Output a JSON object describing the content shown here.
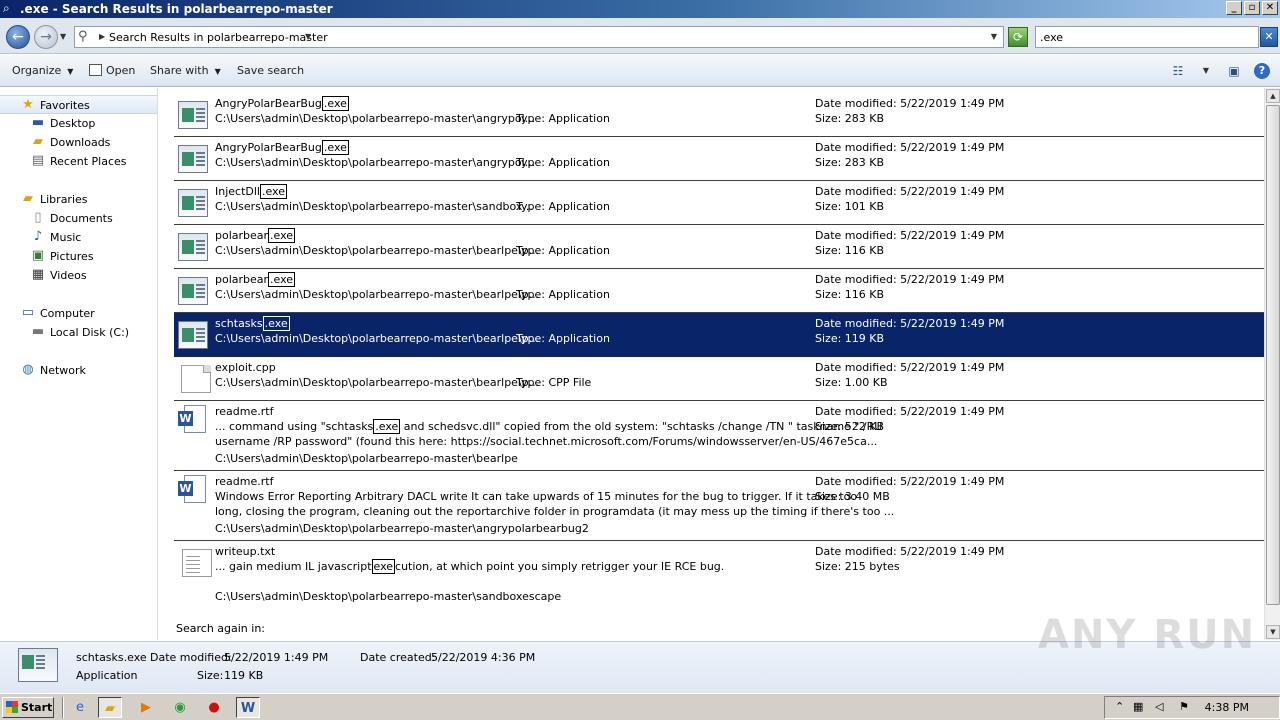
{
  "window": {
    "title": ".exe - Search Results in polarbearrepo-master",
    "buttons": {
      "minimize": "_",
      "maximize": "▫",
      "close": "✕"
    }
  },
  "address": {
    "path": "Search Results in polarbearrepo-master",
    "search_value": ".exe"
  },
  "toolbar": {
    "organize": "Organize",
    "open": "Open",
    "share_with": "Share with",
    "save_search": "Save search"
  },
  "nav": {
    "favorites": "Favorites",
    "desktop": "Desktop",
    "downloads": "Downloads",
    "recent_places": "Recent Places",
    "libraries": "Libraries",
    "documents": "Documents",
    "music": "Music",
    "pictures": "Pictures",
    "videos": "Videos",
    "computer": "Computer",
    "local_disk": "Local Disk (C:)",
    "network": "Network"
  },
  "results": [
    {
      "name_pre": "AngryPolarBearBug",
      "name_hl": ".exe",
      "name_post": "",
      "path": "C:\\Users\\admin\\Desktop\\polarbearrepo-master\\angrypol...",
      "type": "Type: Application",
      "modified": "Date modified: 5/22/2019 1:49 PM",
      "size": "Size: 283 KB"
    },
    {
      "name_pre": "AngryPolarBearBug",
      "name_hl": ".exe",
      "name_post": "",
      "path": "C:\\Users\\admin\\Desktop\\polarbearrepo-master\\angrypol...",
      "type": "Type: Application",
      "modified": "Date modified: 5/22/2019 1:49 PM",
      "size": "Size: 283 KB"
    },
    {
      "name_pre": "InjectDll",
      "name_hl": ".exe",
      "name_post": "",
      "path": "C:\\Users\\admin\\Desktop\\polarbearrepo-master\\sandbox...",
      "type": "Type: Application",
      "modified": "Date modified: 5/22/2019 1:49 PM",
      "size": "Size: 101 KB"
    },
    {
      "name_pre": "polarbear",
      "name_hl": ".exe",
      "name_post": "",
      "path": "C:\\Users\\admin\\Desktop\\polarbearrepo-master\\bearlpe\\p...",
      "type": "Type: Application",
      "modified": "Date modified: 5/22/2019 1:49 PM",
      "size": "Size: 116 KB"
    },
    {
      "name_pre": "polarbear",
      "name_hl": ".exe",
      "name_post": "",
      "path": "C:\\Users\\admin\\Desktop\\polarbearrepo-master\\bearlpe\\p...",
      "type": "Type: Application",
      "modified": "Date modified: 5/22/2019 1:49 PM",
      "size": "Size: 116 KB"
    },
    {
      "name_pre": "schtasks",
      "name_hl": ".exe",
      "name_post": "",
      "path": "C:\\Users\\admin\\Desktop\\polarbearrepo-master\\bearlpe\\p...",
      "type": "Type: Application",
      "modified": "Date modified: 5/22/2019 1:49 PM",
      "size": "Size: 119 KB"
    },
    {
      "name_pre": "exploit.cpp",
      "name_hl": "",
      "name_post": "",
      "path": "C:\\Users\\admin\\Desktop\\polarbearrepo-master\\bearlpe\\p...",
      "type": "Type: CPP File",
      "modified": "Date modified: 5/22/2019 1:49 PM",
      "size": "Size: 1.00 KB"
    }
  ],
  "rich_results": [
    {
      "name": "readme.rtf",
      "line1_pre": "... command using \"schtasks",
      "line1_hl": ".exe",
      "line1_post": " and schedsvc.dll\" copied from the old system: \"schtasks /change /TN \" taskname \" /RU",
      "line2": "username /RP password\" (found this here: https://social.technet.microsoft.com/Forums/windowsserver/en-US/467e5ca...",
      "path": "C:\\Users\\admin\\Desktop\\polarbearrepo-master\\bearlpe",
      "modified": "Date modified: 5/22/2019 1:49 PM",
      "size": "Size: 522 KB"
    },
    {
      "name": "readme.rtf",
      "line1": "Windows Error Reporting Arbitrary DACL write It can take upwards of 15 minutes for the bug to trigger. If it takes too",
      "line2": "long, closing the program, cleaning out the reportarchive folder in programdata (it may mess up the timing if there's too ...",
      "path": "C:\\Users\\admin\\Desktop\\polarbearrepo-master\\angrypolarbearbug2",
      "modified": "Date modified: 5/22/2019 1:49 PM",
      "size": "Size: 3.40 MB"
    },
    {
      "name": "writeup.txt",
      "line1_pre": "... gain medium IL javascript",
      "line1_hl": "exe",
      "line1_post": "cution, at which point you simply retrigger your IE RCE bug.",
      "path": "C:\\Users\\admin\\Desktop\\polarbearrepo-master\\sandboxescape",
      "modified": "Date modified: 5/22/2019 1:49 PM",
      "size": "Size: 215 bytes"
    }
  ],
  "search_again": "Search again in:",
  "details": {
    "name": "schtasks.exe",
    "modified_label": "Date modified:",
    "modified_value": "5/22/2019 1:49 PM",
    "created_label": "Date created:",
    "created_value": "5/22/2019 4:36 PM",
    "type": "Application",
    "size_label": "Size:",
    "size_value": "119 KB"
  },
  "taskbar": {
    "start": "Start",
    "clock": "4:38 PM"
  },
  "watermark": "ANY RUN"
}
